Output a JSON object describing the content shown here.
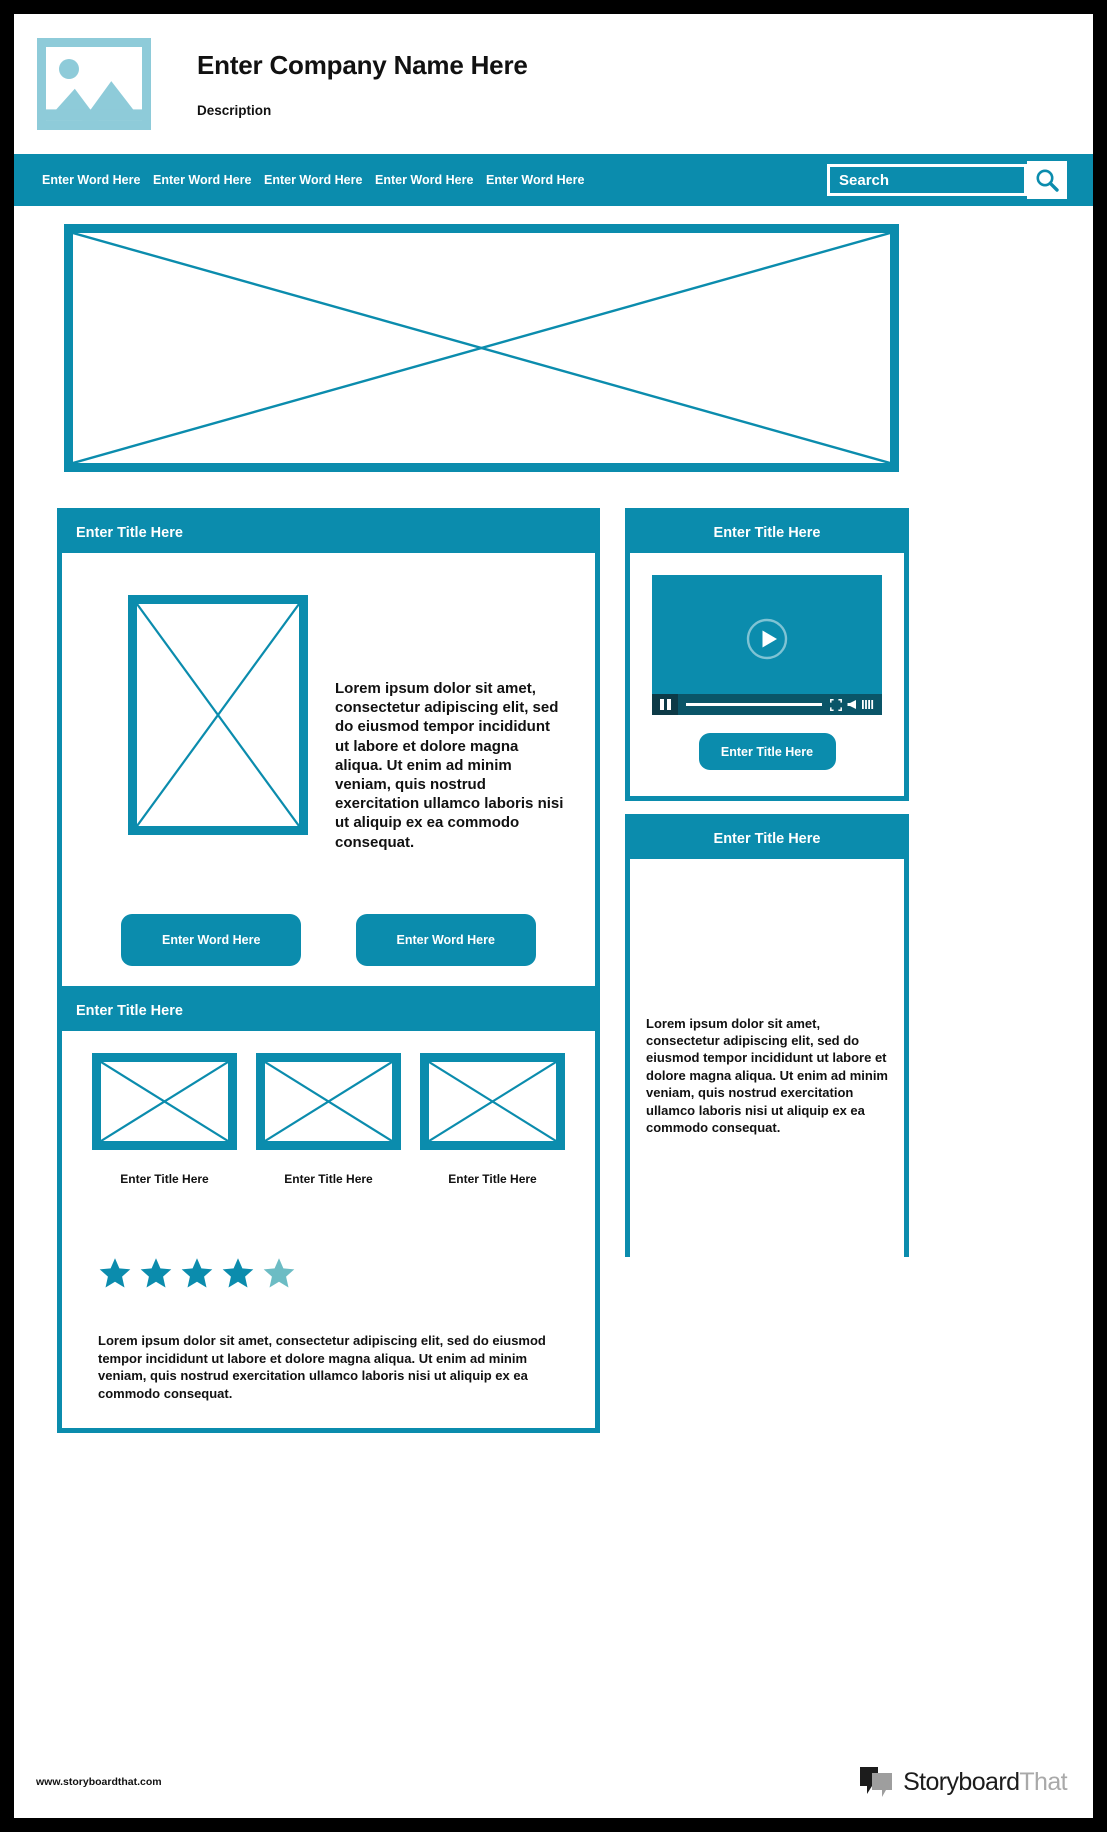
{
  "header": {
    "company_name": "Enter Company Name Here",
    "description": "Description",
    "logo_icon": "image-placeholder-icon"
  },
  "nav": {
    "links": [
      {
        "label": "Enter Word Here"
      },
      {
        "label": "Enter Word Here"
      },
      {
        "label": "Enter Word Here"
      },
      {
        "label": "Enter Word Here"
      },
      {
        "label": "Enter Word Here"
      }
    ],
    "search": {
      "placeholder": "Search",
      "value": "",
      "icon": "search-icon"
    }
  },
  "hero": {
    "placeholder_icon": "image-placeholder-cross"
  },
  "main_card": {
    "title": "Enter Title Here",
    "image_icon": "image-placeholder-cross",
    "paragraph": "Lorem ipsum dolor sit amet, consectetur adipiscing elit, sed do eiusmod tempor incididunt ut labore et dolore magna aliqua. Ut enim ad minim veniam, quis nostrud exercitation ullamco laboris nisi ut aliquip ex ea commodo consequat.",
    "buttons": [
      {
        "label": "Enter Word Here"
      },
      {
        "label": "Enter Word Here"
      }
    ]
  },
  "gallery_card": {
    "title": "Enter Title Here",
    "thumbnails": [
      {
        "label": "Enter Title Here",
        "icon": "image-placeholder-cross"
      },
      {
        "label": "Enter Title Here",
        "icon": "image-placeholder-cross"
      },
      {
        "label": "Enter Title Here",
        "icon": "image-placeholder-cross"
      }
    ],
    "rating": {
      "filled": 4,
      "total": 5,
      "filled_color": "#0b8cad",
      "empty_color": "#6cbcc4"
    },
    "review": "Lorem ipsum dolor sit amet, consectetur adipiscing elit, sed do eiusmod tempor incididunt ut labore et dolore magna aliqua. Ut enim ad minim veniam, quis nostrud exercitation ullamco laboris nisi ut aliquip ex ea commodo consequat."
  },
  "video_card": {
    "title": "Enter Title Here",
    "play_icon": "play-button-icon",
    "controls": {
      "pause_icon": "pause-icon",
      "progress_icon": "progress-bar",
      "fullscreen_icon": "fullscreen-icon",
      "volume_icon": "volume-speaker-icon",
      "volume_level_icon": "volume-bars-icon"
    },
    "button_label": "Enter Title Here"
  },
  "text_card": {
    "title": "Enter Title Here",
    "paragraph": "Lorem ipsum dolor sit amet, consectetur adipiscing elit, sed do eiusmod tempor incididunt ut labore et dolore magna aliqua. Ut enim ad minim veniam, quis nostrud exercitation ullamco laboris nisi ut aliquip ex ea commodo consequat."
  },
  "footer": {
    "url": "www.storyboardthat.com",
    "brand_first": "Storyboard",
    "brand_second": "That",
    "brand_icon": "speech-bubbles-icon"
  },
  "colors": {
    "accent": "#0b8cad",
    "accent_light": "#8ecbd9",
    "star_empty": "#6cbcc4",
    "video_controls": "#0a5568"
  }
}
